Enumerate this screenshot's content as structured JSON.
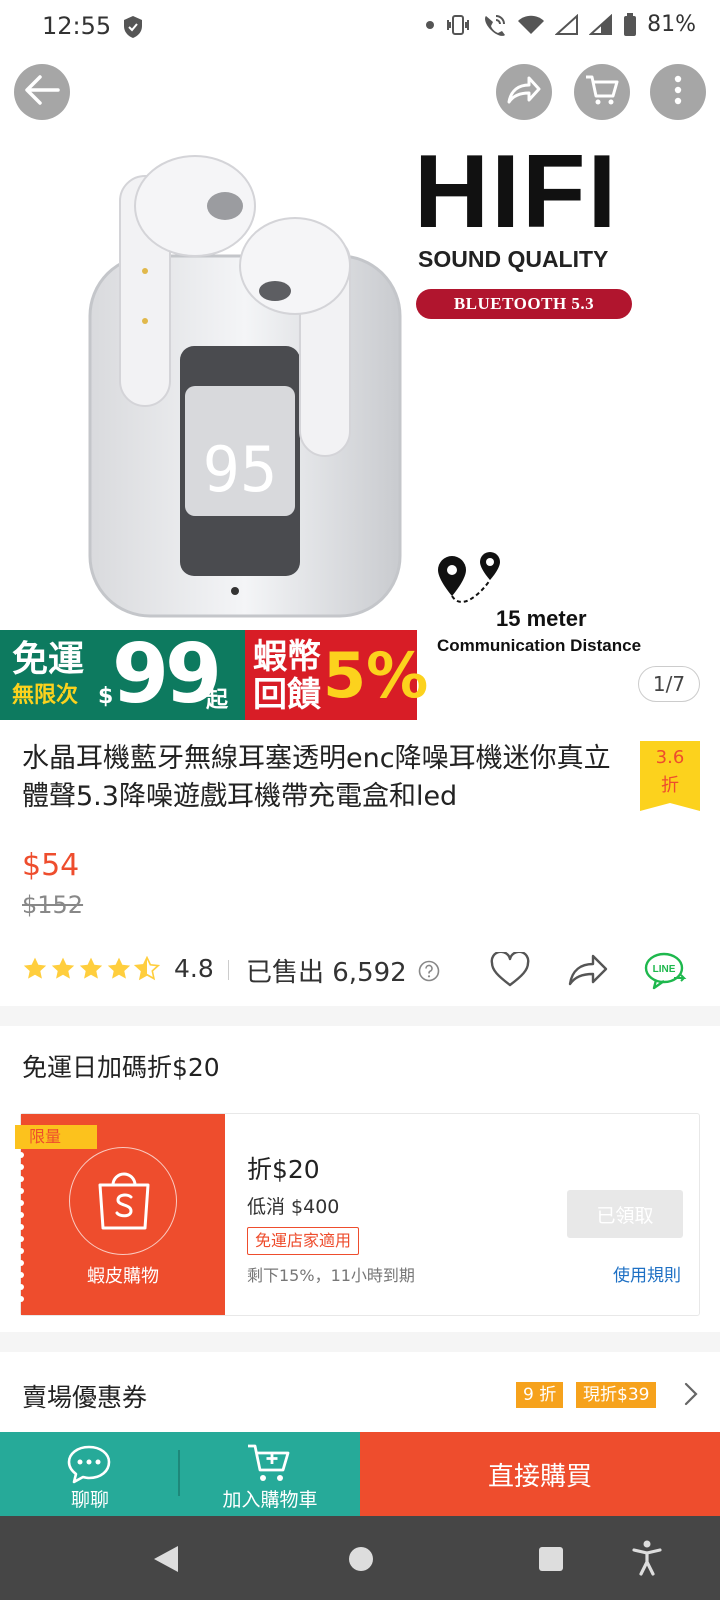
{
  "status_bar": {
    "time": "12:55",
    "battery": "81%"
  },
  "hero": {
    "page_indicator": "1/7",
    "hifi_title": "HIFI",
    "hifi_subtitle": "SOUND QUALITY",
    "bluetooth_badge": "BLUETOOTH 5.3",
    "range_title": "15 meter",
    "range_subtitle": "Communication  Distance",
    "promo_free_ship_line1": "免運",
    "promo_free_ship_line2": "無限次",
    "promo_currency": "$",
    "promo_amount": "99",
    "promo_suffix": "起",
    "promo_coins_line1": "蝦幣",
    "promo_coins_line2": "回饋",
    "promo_coins_pct": "5%",
    "case_display": "95"
  },
  "product": {
    "title": "水晶耳機藍牙無線耳塞透明enc降噪耳機迷你真立體聲5.3降噪遊戲耳機帶充電盒和led",
    "discount_value": "3.6",
    "discount_unit": "折",
    "price": "$54",
    "original_price": "$152",
    "rating": "4.8",
    "rating_stars": 4.5,
    "sold": "已售出 6,592",
    "line_label": "LINE"
  },
  "free_shipping_day": {
    "title": "免運日加碼折$20",
    "voucher": {
      "limited_label": "限量",
      "shop_name": "蝦皮購物",
      "amount": "折$20",
      "min_spend": "低消 $400",
      "ship_tag": "免運店家適用",
      "remaining": "剩下15%，11小時到期",
      "claimed_label": "已領取",
      "rules_label": "使用規則"
    }
  },
  "shop_vouchers": {
    "label": "賣場優惠券",
    "tags": [
      "9 折",
      "現折$39"
    ]
  },
  "actions": {
    "chat_label": "聊聊",
    "cart_label": "加入購物車",
    "buy_label": "直接購買"
  },
  "colors": {
    "brand": "#ee4d2d",
    "teal": "#26aa99",
    "star": "#ffce3d"
  }
}
